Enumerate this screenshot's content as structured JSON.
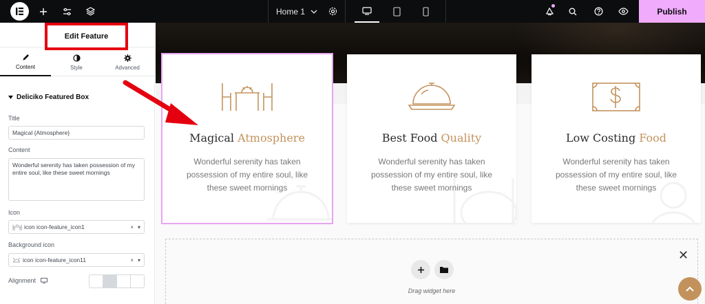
{
  "topbar": {
    "page_name": "Home 1",
    "publish_label": "Publish",
    "accent_color": "#f0abfc"
  },
  "panel": {
    "title": "Edit Feature",
    "tabs": [
      {
        "label": "Content",
        "icon": "pencil-icon",
        "active": true
      },
      {
        "label": "Style",
        "icon": "half-circle-icon",
        "active": false
      },
      {
        "label": "Advanced",
        "icon": "gear-icon",
        "active": false
      }
    ],
    "section_title": "Deliciko Featured Box",
    "fields": {
      "title_label": "Title",
      "title_value": "Magical {Atmosphere}",
      "content_label": "Content",
      "content_value": "Wonderful serenity has taken possession of my entire soul, like these sweet mornings",
      "icon_label": "Icon",
      "icon_value": "icon icon-feature_icon1",
      "bg_icon_label": "Background icon",
      "bg_icon_value": "icon icon-feature_icon11",
      "alignment_label": "Alignment"
    }
  },
  "cards": [
    {
      "title_plain": "Magical ",
      "title_accent": "Atmosphere",
      "text": "Wonderful serenity has taken possession of my entire soul, like these sweet mornings",
      "icon": "dining-table-icon"
    },
    {
      "title_plain": "Best Food ",
      "title_accent": "Quality",
      "text": "Wonderful serenity has taken possession of my entire soul, like these sweet mornings",
      "icon": "food-cloche-icon"
    },
    {
      "title_plain": "Low Costing ",
      "title_accent": "Food",
      "text": "Wonderful serenity has taken possession of my entire soul, like these sweet mornings",
      "icon": "dollar-bill-icon"
    }
  ],
  "canvas": {
    "drag_text": "Drag widget here",
    "accent_color": "#c3925c"
  }
}
